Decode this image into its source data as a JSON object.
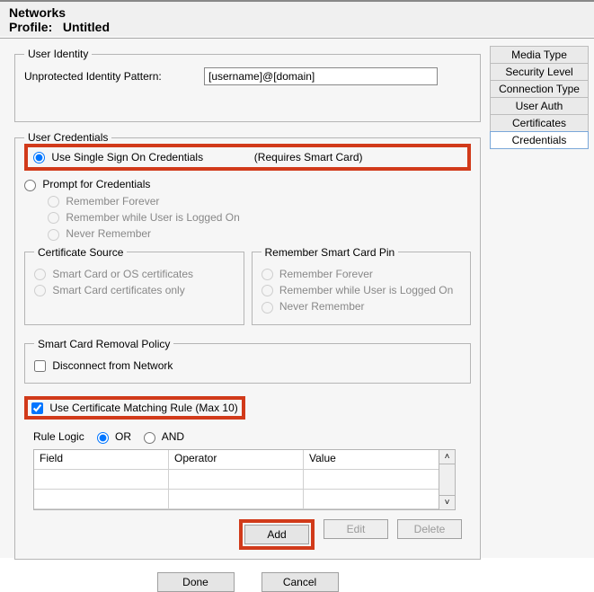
{
  "header": {
    "title": "Networks",
    "profile_prefix": "Profile:",
    "profile_name": "Untitled"
  },
  "tabs": {
    "items": [
      {
        "label": "Media Type"
      },
      {
        "label": "Security Level"
      },
      {
        "label": "Connection Type"
      },
      {
        "label": "User Auth"
      },
      {
        "label": "Certificates"
      },
      {
        "label": "Credentials"
      }
    ],
    "active_index": 5
  },
  "identity": {
    "legend": "User Identity",
    "pattern_label": "Unprotected Identity Pattern:",
    "pattern_value": "[username]@[domain]"
  },
  "credentials": {
    "legend": "User Credentials",
    "sso_label": "Use Single Sign On Credentials",
    "sso_note": "(Requires Smart Card)",
    "prompt_label": "Prompt for Credentials",
    "remember_forever": "Remember Forever",
    "remember_logged": "Remember while User is Logged On",
    "never_remember": "Never Remember"
  },
  "cert_source": {
    "legend": "Certificate Source",
    "opt1": "Smart Card or OS certificates",
    "opt2": "Smart Card certificates only"
  },
  "pin": {
    "legend": "Remember Smart Card Pin",
    "opt1": "Remember Forever",
    "opt2": "Remember while User is Logged On",
    "opt3": "Never Remember"
  },
  "removal": {
    "legend": "Smart Card Removal Policy",
    "disconnect": "Disconnect from Network"
  },
  "matching": {
    "use_rule": "Use Certificate Matching Rule (Max 10)",
    "rule_logic_label": "Rule Logic",
    "or": "OR",
    "and": "AND",
    "columns": {
      "field": "Field",
      "operator": "Operator",
      "value": "Value"
    }
  },
  "buttons": {
    "add": "Add",
    "edit": "Edit",
    "delete": "Delete",
    "done": "Done",
    "cancel": "Cancel"
  }
}
